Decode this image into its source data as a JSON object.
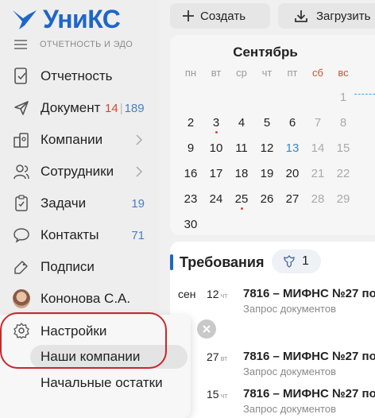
{
  "sidebar": {
    "logo_text": "УниКС",
    "subtitle": "ОТЧЕТНОСТЬ И ЭДО",
    "items": [
      {
        "label": "Отчетность",
        "icon": "report-icon"
      },
      {
        "label": "Документ",
        "icon": "send-icon",
        "count_red": "14",
        "count_blue": "189"
      },
      {
        "label": "Компании",
        "icon": "companies-icon"
      },
      {
        "label": "Сотрудники",
        "icon": "employees-icon"
      },
      {
        "label": "Задачи",
        "icon": "tasks-icon",
        "count": "19"
      },
      {
        "label": "Контакты",
        "icon": "contacts-icon",
        "count": "71"
      },
      {
        "label": "Подписи",
        "icon": "signature-icon"
      },
      {
        "label": "Кононова С.А.",
        "icon": "avatar"
      }
    ]
  },
  "popover": {
    "title": "Настройки",
    "items": [
      "Наши компании",
      "Начальные остатки"
    ]
  },
  "toolbar": {
    "create_label": "Создать",
    "upload_label": "Загрузить"
  },
  "calendar": {
    "month": "Сентябрь",
    "weekdays": [
      "пн",
      "вт",
      "ср",
      "чт",
      "пт",
      "сб",
      "вс"
    ],
    "weeks": [
      [
        "",
        "",
        "",
        "",
        "",
        "",
        "1"
      ],
      [
        "2",
        "3",
        "4",
        "5",
        "6",
        "7",
        "8"
      ],
      [
        "9",
        "10",
        "11",
        "12",
        "13",
        "14",
        "15"
      ],
      [
        "16",
        "17",
        "18",
        "19",
        "20",
        "21",
        "22"
      ],
      [
        "23",
        "24",
        "25",
        "26",
        "27",
        "28",
        "29"
      ],
      [
        "30",
        "",
        "",
        "",
        "",
        "",
        ""
      ]
    ],
    "today": "13",
    "marked_days": [
      "3",
      "25"
    ],
    "colors": {
      "weekend_header": "#c9552f",
      "today": "#3a89c9",
      "marker": "#d9472b"
    }
  },
  "requirements": {
    "title": "Требования",
    "badge_count": "1",
    "rows": [
      {
        "month": "сен",
        "day": "12",
        "dow": "чт",
        "title": "7816 – МИФНС №27 по",
        "subtitle": "Запрос документов"
      },
      {
        "month": "",
        "day": "27",
        "dow": "вт",
        "title": "7816 – МИФНС №27 по",
        "subtitle": "Запрос документов"
      },
      {
        "month": "",
        "day": "15",
        "dow": "чт",
        "title": "7816 – МИФНС №27 по",
        "subtitle": "Запрос документов"
      }
    ]
  },
  "colors": {
    "brand": "#1e66c8",
    "annotation": "#c8282e"
  }
}
